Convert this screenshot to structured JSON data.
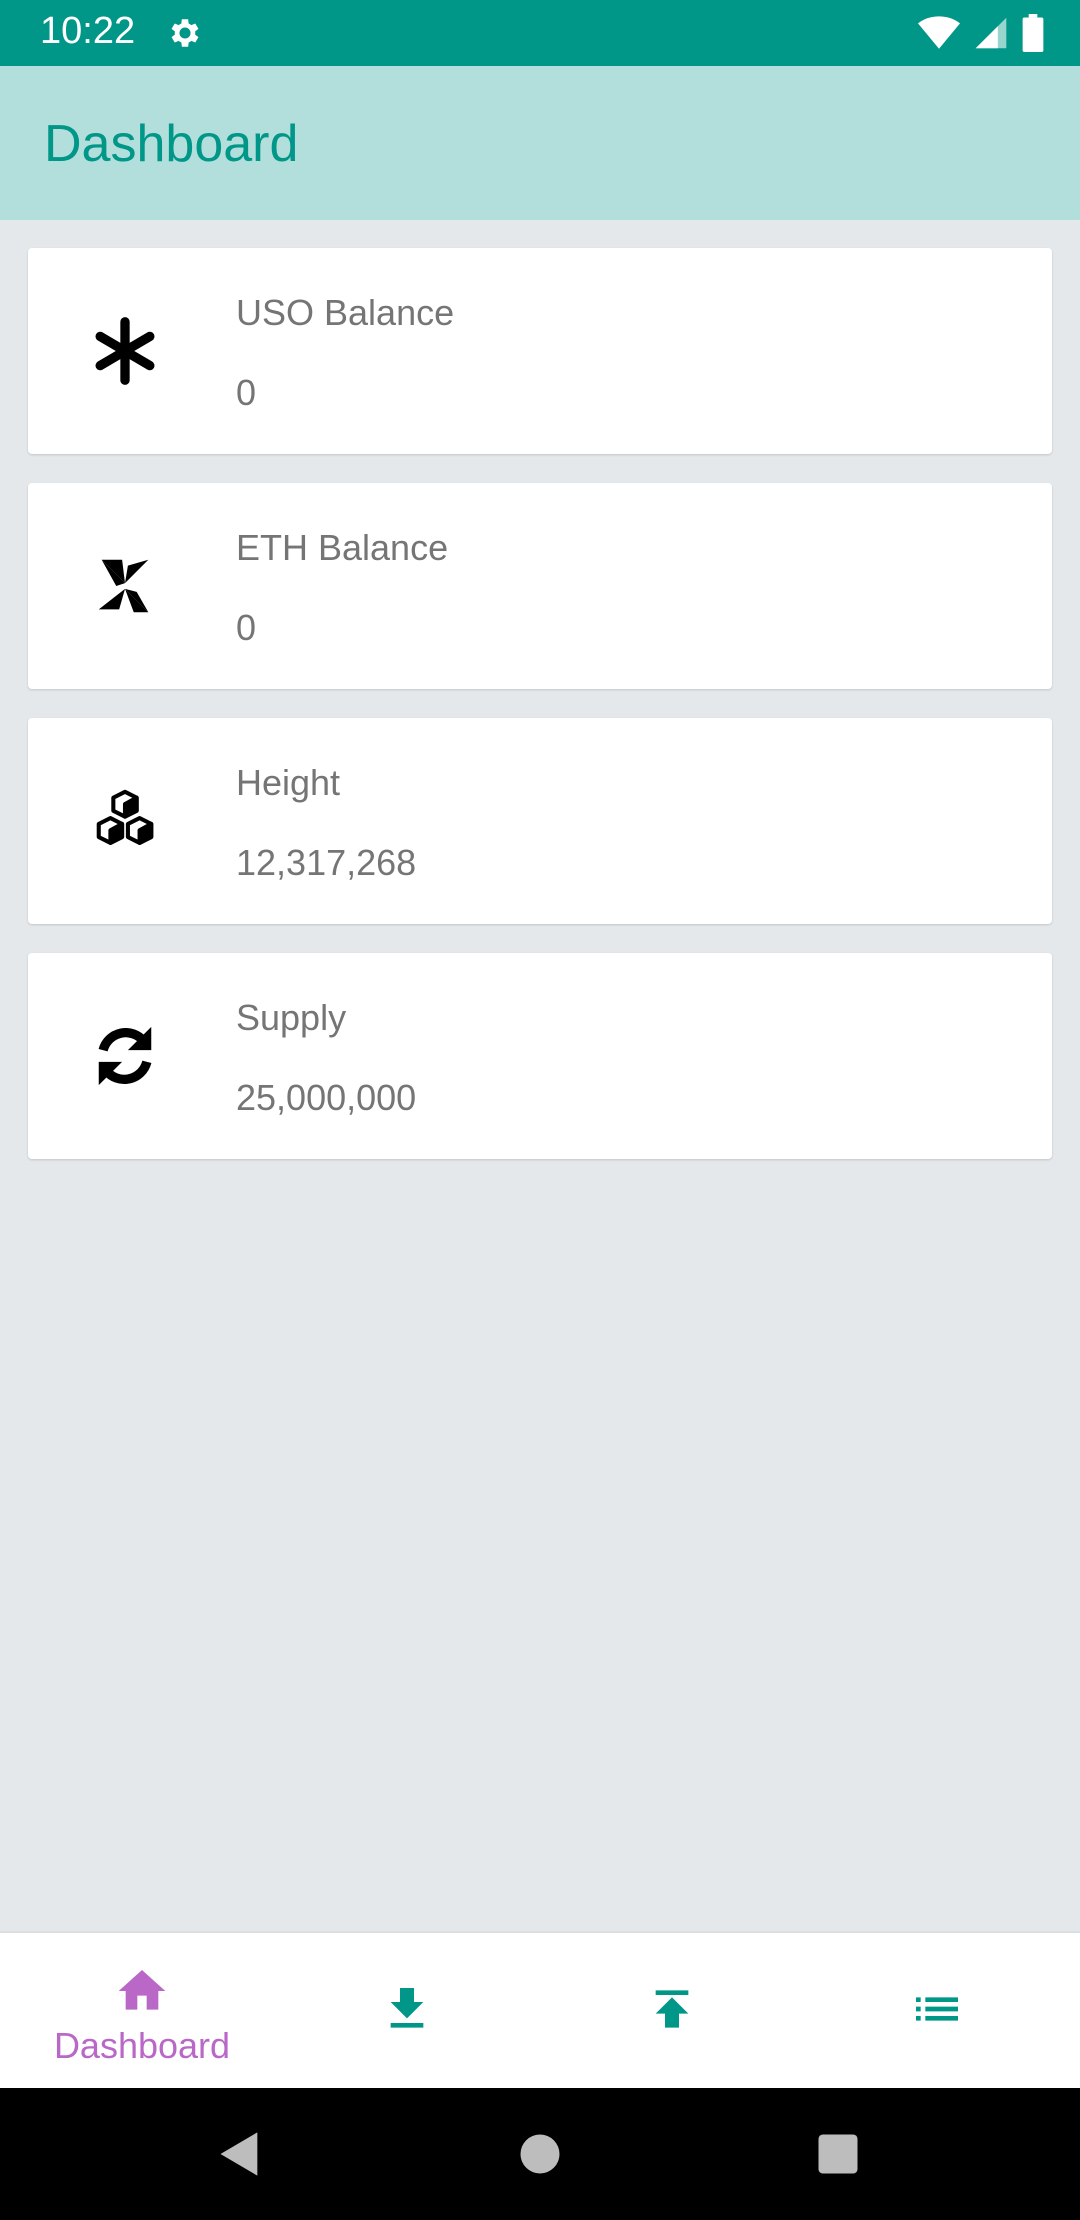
{
  "status_bar": {
    "time": "10:22",
    "icons": [
      "gear-icon",
      "wifi-icon",
      "cell-signal-icon",
      "battery-icon"
    ],
    "background": "#009688"
  },
  "app_bar": {
    "title": "Dashboard",
    "background": "#b2dfdb",
    "title_color": "#009688"
  },
  "cards": [
    {
      "icon": "asterisk-icon",
      "label": "USO Balance",
      "value": "0"
    },
    {
      "icon": "windmill-icon",
      "label": "ETH Balance",
      "value": "0"
    },
    {
      "icon": "cubes-icon",
      "label": "Height",
      "value": "12,317,268"
    },
    {
      "icon": "sync-icon",
      "label": "Supply",
      "value": "25,000,000"
    }
  ],
  "bottom_nav": {
    "items": [
      {
        "icon": "home-icon",
        "label": "Dashboard",
        "active": true
      },
      {
        "icon": "download-icon",
        "label": "",
        "active": false
      },
      {
        "icon": "upload-icon",
        "label": "",
        "active": false
      },
      {
        "icon": "list-icon",
        "label": "",
        "active": false
      }
    ],
    "active_color": "#ba68c8",
    "inactive_color": "#009688"
  },
  "system_nav": {
    "icons": [
      "back-icon",
      "home-circle-icon",
      "recents-icon"
    ]
  }
}
